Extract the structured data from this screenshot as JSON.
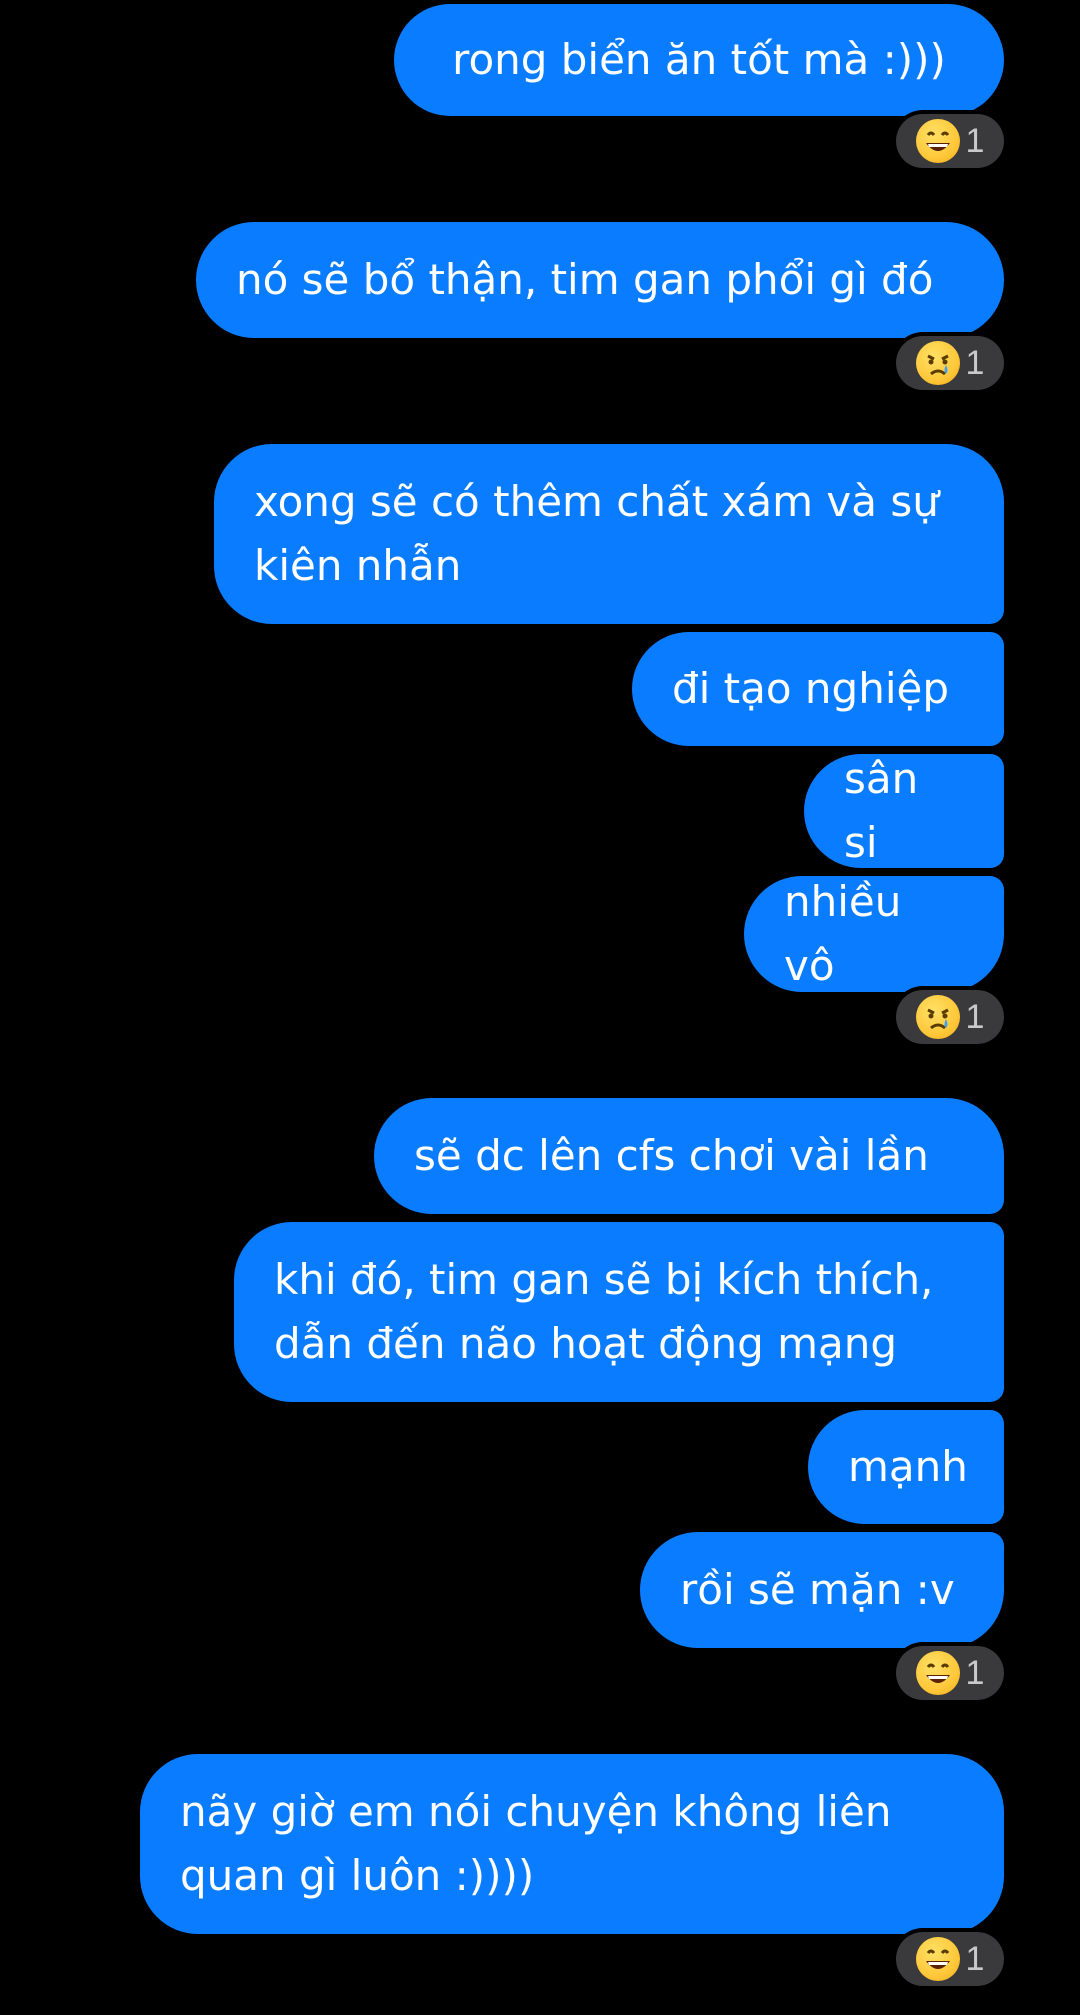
{
  "messages": [
    {
      "text": "rong biển ăn tốt mà :)))"
    },
    {
      "text": "nó sẽ bổ thận, tim gan phổi gì đó"
    },
    {
      "text": "xong sẽ có thêm chất xám và sự kiên nhẫn"
    },
    {
      "text": "đi tạo nghiệp"
    },
    {
      "text": "sân si"
    },
    {
      "text": "nhiều vô"
    },
    {
      "text": "sẽ dc lên cfs chơi vài lần"
    },
    {
      "text": "khi đó, tim gan sẽ bị kích thích, dẫn đến não hoạt động mạng"
    },
    {
      "text": "mạnh"
    },
    {
      "text": "rồi sẽ mặn :v"
    },
    {
      "text": "nãy giờ em nói chuyện không liên quan gì luôn :))))"
    }
  ],
  "reactions": [
    {
      "emoji": "grinning-face-icon",
      "count": "1"
    },
    {
      "emoji": "crying-face-icon",
      "count": "1"
    },
    {
      "emoji": "crying-face-icon",
      "count": "1"
    },
    {
      "emoji": "grinning-face-icon",
      "count": "1"
    },
    {
      "emoji": "grinning-face-icon",
      "count": "1"
    }
  ],
  "colors": {
    "background": "#000000",
    "bubble": "#0a7cff",
    "reaction_pill": "#3a3a3c"
  }
}
